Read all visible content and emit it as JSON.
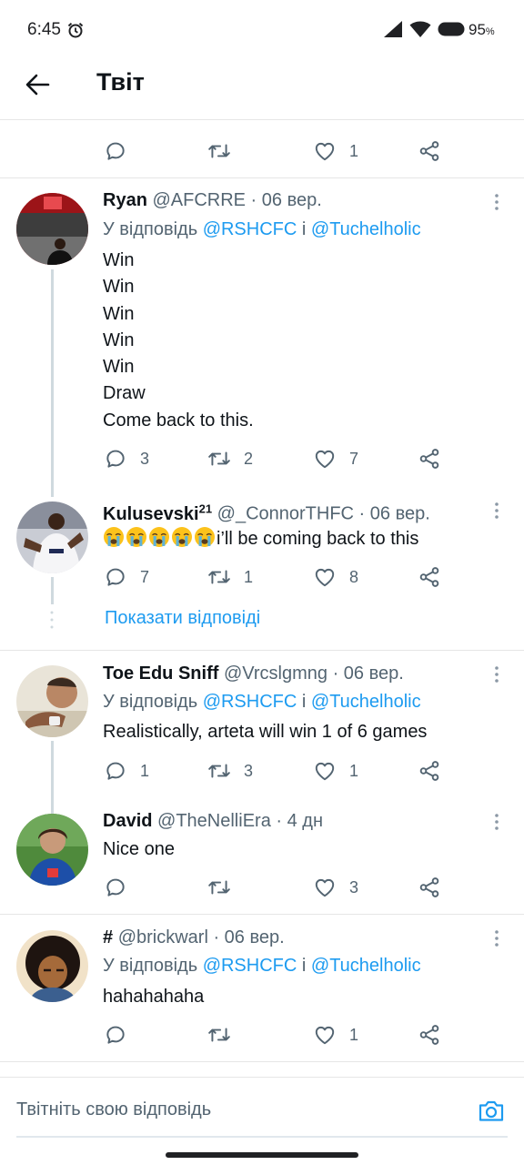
{
  "status_bar": {
    "time": "6:45",
    "battery": "95",
    "battery_unit": "%"
  },
  "header": {
    "title": "Твіт"
  },
  "top_partial": {
    "likes": "1"
  },
  "tweets": [
    {
      "name": "Ryan",
      "handle": "@AFCRRE",
      "time": "06 вер.",
      "reply_prefix": "У відповідь",
      "mention1": "@RSHCFC",
      "conj": "і",
      "mention2": "@Tuchelholic",
      "lines": [
        "Win",
        "Win",
        "Win",
        "Win",
        "Win",
        "Draw",
        "Come back to this."
      ],
      "replies": "3",
      "retweets": "2",
      "likes": "7"
    },
    {
      "name": "Kulusevski",
      "name_sup": "21",
      "handle": "@_ConnorTHFC",
      "time": "06 вер.",
      "text": "i’ll be coming back to this",
      "replies": "7",
      "retweets": "1",
      "likes": "8"
    },
    {
      "name": "Toe Edu Sniff",
      "handle": "@Vrcslgmng",
      "time": "06 вер.",
      "reply_prefix": "У відповідь",
      "mention1": "@RSHCFC",
      "conj": "і",
      "mention2": "@Tuchelholic",
      "text": "Realistically, arteta will win 1 of 6 games",
      "replies": "1",
      "retweets": "3",
      "likes": "1"
    },
    {
      "name": "David",
      "handle": "@TheNelliEra",
      "time": "4 дн",
      "text": "Nice one",
      "likes": "3"
    },
    {
      "name": "#",
      "handle": "@brickwarl",
      "time": "06 вер.",
      "reply_prefix": "У відповідь",
      "mention1": "@RSHCFC",
      "conj": "і",
      "mention2": "@Tuchelholic",
      "text": "hahahahaha",
      "likes": "1"
    }
  ],
  "show_replies": "Показати відповіді",
  "reply_box": {
    "placeholder": "Твітніть свою відповідь"
  },
  "colors": {
    "accent": "#1d9bf0",
    "secondary_text": "#536471",
    "divider": "#e6e6e6"
  },
  "icons": [
    "alarm-icon",
    "signal-icon",
    "wifi-icon",
    "battery-icon",
    "back-icon",
    "reply-icon",
    "retweet-icon",
    "like-icon",
    "share-icon",
    "more-icon",
    "crying-emoji-icon",
    "camera-icon"
  ]
}
